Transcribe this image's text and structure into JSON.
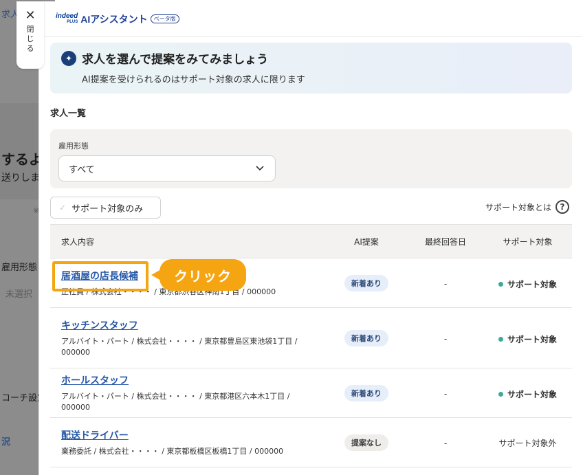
{
  "background": {
    "fragments": [
      "求人",
      "するよう",
      "送りしま",
      "※",
      "雇用形態",
      "未選択",
      "コーチ設定",
      "況"
    ]
  },
  "close": {
    "icon": "close-icon",
    "label": "閉じる"
  },
  "header": {
    "logo_brand": "indeed",
    "logo_sub": "PLUS",
    "title": "AIアシスタント",
    "beta": "ベータ版"
  },
  "banner": {
    "icon": "sparkle-icon",
    "title": "求人を選んで提案をみてみましょう",
    "subtitle": "AI提案を受けられるのはサポート対象の求人に限ります"
  },
  "list_title": "求人一覧",
  "filter": {
    "label": "雇用形態",
    "value": "すべて"
  },
  "toggle": {
    "label": "サポート対象のみ"
  },
  "support_help": {
    "label": "サポート対象とは",
    "icon": "question-icon"
  },
  "table": {
    "headers": [
      "求人内容",
      "AI提案",
      "最終回答日",
      "サポート対象"
    ],
    "rows": [
      {
        "title": "居酒屋の店長候補",
        "meta": "正社員 / 株式会社・・・・ / 東京都渋谷区神南1丁目 / 000000",
        "ai": "新着あり",
        "date": "-",
        "support": "サポート対象"
      },
      {
        "title": "キッチンスタッフ",
        "meta": "アルバイト・パート / 株式会社・・・・ / 東京都豊島区東池袋1丁目 / 000000",
        "ai": "新着あり",
        "date": "-",
        "support": "サポート対象"
      },
      {
        "title": "ホールスタッフ",
        "meta": "アルバイト・パート / 株式会社・・・・ / 東京都港区六本木1丁目 / 000000",
        "ai": "新着あり",
        "date": "-",
        "support": "サポート対象"
      },
      {
        "title": "配送ドライバー",
        "meta": "業務委託 / 株式会社・・・・ / 東京都板橋区板橋1丁目 / 000000",
        "ai": "提案なし",
        "date": "-",
        "support": "サポート対象外"
      }
    ]
  },
  "annotation": {
    "label": "クリック"
  },
  "colors": {
    "accent": "#f5a511",
    "link": "#2557a7",
    "support_dot": "#3aaa9a"
  }
}
